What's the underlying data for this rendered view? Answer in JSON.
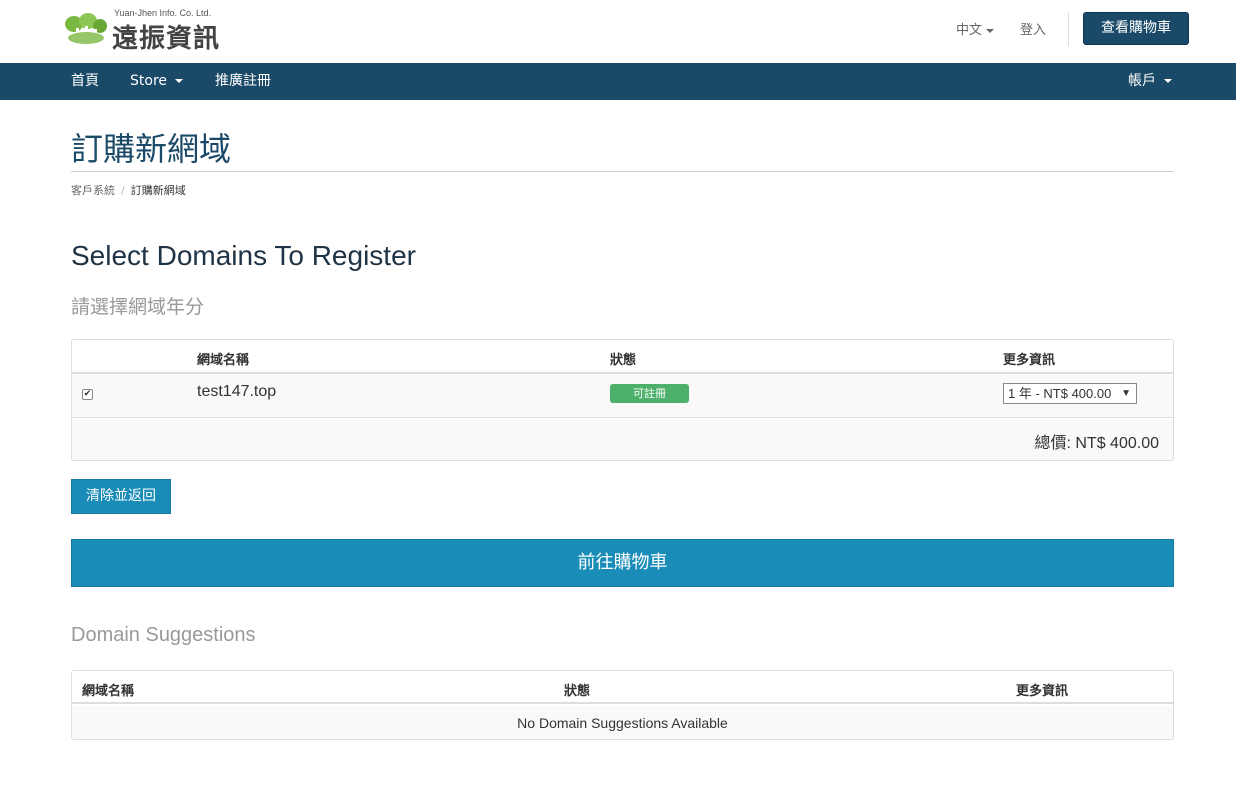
{
  "header": {
    "logo_sub": "Yuan-Jhen Info. Co. Ltd.",
    "logo_main": "遠振資訊",
    "language": "中文",
    "login": "登入",
    "view_cart": "查看購物車"
  },
  "nav": {
    "home": "首頁",
    "store": "Store",
    "affiliate": "推廣註冊",
    "account": "帳戶"
  },
  "page": {
    "title": "訂購新網域",
    "breadcrumb": [
      "客戶系統",
      "訂購新網域"
    ]
  },
  "register": {
    "heading": "Select Domains To Register",
    "subheading": "請選擇網域年分",
    "columns": [
      "網域名稱",
      "狀態",
      "更多資訊"
    ],
    "rows": [
      {
        "checked": true,
        "domain": "test147.top",
        "status": "可註冊",
        "period": "1 年 - NT$ 400.00"
      }
    ],
    "total": "總價: NT$ 400.00",
    "clear_button": "清除並返回",
    "checkout_button": "前往購物車"
  },
  "suggestions": {
    "heading": "Domain Suggestions",
    "columns": [
      "網域名稱",
      "狀態",
      "更多資訊"
    ],
    "empty": "No Domain Suggestions Available"
  },
  "colors": {
    "primary": "#1a4a68",
    "button": "#1a8cb8",
    "status_available": "#4caf6a"
  }
}
